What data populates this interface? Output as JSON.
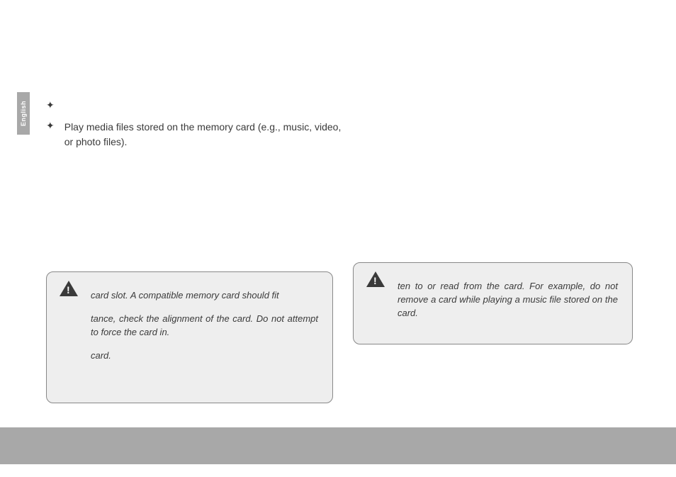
{
  "sideTab": {
    "label": "English"
  },
  "content": {
    "bullets": [
      "",
      "Play media files stored on the memory card (e.g., music, video, or photo files)."
    ]
  },
  "warningLeft": {
    "para1": "card slot. A compatible memory card should fit",
    "para2": "tance, check the alignment of the card. Do not attempt to force the card in.",
    "para3": "card."
  },
  "warningRight": {
    "para1": "ten to or read from the card. For example, do not remove a card while playing a music file stored on the card."
  }
}
